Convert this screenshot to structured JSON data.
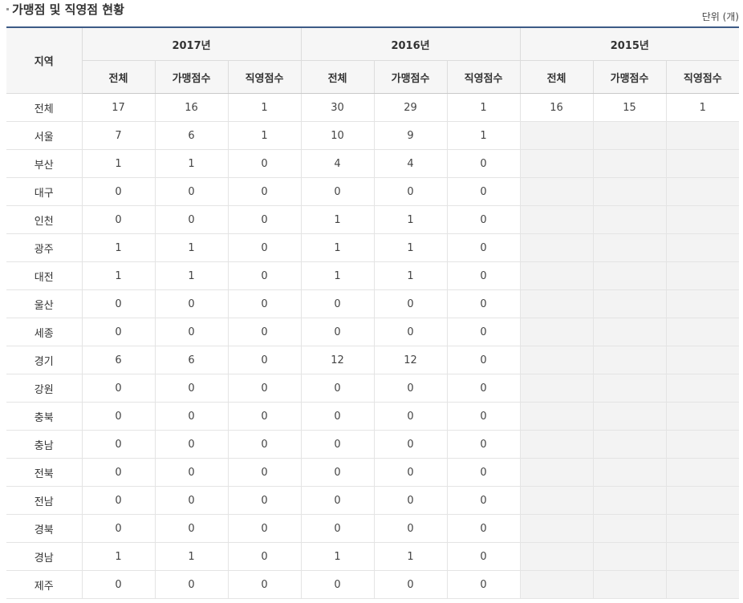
{
  "section": {
    "title": "가맹점 및 직영점 현황",
    "unit": "단위 (개)"
  },
  "table": {
    "region_header": "지역",
    "years": [
      "2017년",
      "2016년",
      "2015년"
    ],
    "sub_headers": [
      "전체",
      "가맹점수",
      "직영점수"
    ],
    "rows": [
      {
        "region": "전체",
        "y2017": [
          "17",
          "16",
          "1"
        ],
        "y2016": [
          "30",
          "29",
          "1"
        ],
        "y2015": [
          "16",
          "15",
          "1"
        ]
      },
      {
        "region": "서울",
        "y2017": [
          "7",
          "6",
          "1"
        ],
        "y2016": [
          "10",
          "9",
          "1"
        ],
        "y2015": [
          "",
          "",
          ""
        ]
      },
      {
        "region": "부산",
        "y2017": [
          "1",
          "1",
          "0"
        ],
        "y2016": [
          "4",
          "4",
          "0"
        ],
        "y2015": [
          "",
          "",
          ""
        ]
      },
      {
        "region": "대구",
        "y2017": [
          "0",
          "0",
          "0"
        ],
        "y2016": [
          "0",
          "0",
          "0"
        ],
        "y2015": [
          "",
          "",
          ""
        ]
      },
      {
        "region": "인천",
        "y2017": [
          "0",
          "0",
          "0"
        ],
        "y2016": [
          "1",
          "1",
          "0"
        ],
        "y2015": [
          "",
          "",
          ""
        ]
      },
      {
        "region": "광주",
        "y2017": [
          "1",
          "1",
          "0"
        ],
        "y2016": [
          "1",
          "1",
          "0"
        ],
        "y2015": [
          "",
          "",
          ""
        ]
      },
      {
        "region": "대전",
        "y2017": [
          "1",
          "1",
          "0"
        ],
        "y2016": [
          "1",
          "1",
          "0"
        ],
        "y2015": [
          "",
          "",
          ""
        ]
      },
      {
        "region": "울산",
        "y2017": [
          "0",
          "0",
          "0"
        ],
        "y2016": [
          "0",
          "0",
          "0"
        ],
        "y2015": [
          "",
          "",
          ""
        ]
      },
      {
        "region": "세종",
        "y2017": [
          "0",
          "0",
          "0"
        ],
        "y2016": [
          "0",
          "0",
          "0"
        ],
        "y2015": [
          "",
          "",
          ""
        ]
      },
      {
        "region": "경기",
        "y2017": [
          "6",
          "6",
          "0"
        ],
        "y2016": [
          "12",
          "12",
          "0"
        ],
        "y2015": [
          "",
          "",
          ""
        ]
      },
      {
        "region": "강원",
        "y2017": [
          "0",
          "0",
          "0"
        ],
        "y2016": [
          "0",
          "0",
          "0"
        ],
        "y2015": [
          "",
          "",
          ""
        ]
      },
      {
        "region": "충북",
        "y2017": [
          "0",
          "0",
          "0"
        ],
        "y2016": [
          "0",
          "0",
          "0"
        ],
        "y2015": [
          "",
          "",
          ""
        ]
      },
      {
        "region": "충남",
        "y2017": [
          "0",
          "0",
          "0"
        ],
        "y2016": [
          "0",
          "0",
          "0"
        ],
        "y2015": [
          "",
          "",
          ""
        ]
      },
      {
        "region": "전북",
        "y2017": [
          "0",
          "0",
          "0"
        ],
        "y2016": [
          "0",
          "0",
          "0"
        ],
        "y2015": [
          "",
          "",
          ""
        ]
      },
      {
        "region": "전남",
        "y2017": [
          "0",
          "0",
          "0"
        ],
        "y2016": [
          "0",
          "0",
          "0"
        ],
        "y2015": [
          "",
          "",
          ""
        ]
      },
      {
        "region": "경북",
        "y2017": [
          "0",
          "0",
          "0"
        ],
        "y2016": [
          "0",
          "0",
          "0"
        ],
        "y2015": [
          "",
          "",
          ""
        ]
      },
      {
        "region": "경남",
        "y2017": [
          "1",
          "1",
          "0"
        ],
        "y2016": [
          "1",
          "1",
          "0"
        ],
        "y2015": [
          "",
          "",
          ""
        ]
      },
      {
        "region": "제주",
        "y2017": [
          "0",
          "0",
          "0"
        ],
        "y2016": [
          "0",
          "0",
          "0"
        ],
        "y2015": [
          "",
          "",
          ""
        ]
      }
    ]
  },
  "colors": {
    "header_top_border": "#3c5a86",
    "header_background": "#f6f6f6",
    "empty_cell_background": "#f3f3f3"
  }
}
